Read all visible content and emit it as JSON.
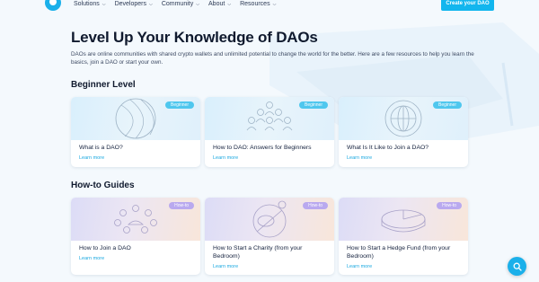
{
  "nav": {
    "items": [
      {
        "label": "Solutions"
      },
      {
        "label": "Developers"
      },
      {
        "label": "Community"
      },
      {
        "label": "About"
      },
      {
        "label": "Resources"
      }
    ],
    "cta_label": "Create your DAO"
  },
  "hero": {
    "title": "Level Up Your Knowledge of DAOs",
    "intro": "DAOs are online communities with shared crypto wallets and unlimited potential to change the world for the better. Here are a few resources to help you learn the basics, join a DAO or start your own."
  },
  "sections": {
    "beginner": {
      "title": "Beginner Level",
      "badge": "Beginner",
      "cards": [
        {
          "title": "What is a DAO?",
          "link": "Learn more",
          "icon": "sphere-illustration"
        },
        {
          "title": "How to DAO: Answers for Beginners",
          "link": "Learn more",
          "icon": "people-group-illustration"
        },
        {
          "title": "What Is It Like to Join a DAO?",
          "link": "Learn more",
          "icon": "globe-illustration"
        }
      ]
    },
    "howto": {
      "title": "How-to Guides",
      "badge": "How-to",
      "cards": [
        {
          "title": "How to Join a DAO",
          "link": "Learn more",
          "icon": "community-circle-illustration"
        },
        {
          "title": "How to Start a Charity (from your Bedroom)",
          "link": "Learn more",
          "icon": "piggy-bank-illustration"
        },
        {
          "title": "How to Start a Hedge Fund (from your Bedroom)",
          "link": "Learn more",
          "icon": "pie-chart-illustration"
        }
      ]
    }
  },
  "colors": {
    "accent": "#12b6ee",
    "beginner_badge": "#4fc7ee",
    "howto_badge": "#b9a9ef",
    "link": "#1aa8e0"
  },
  "fab": {
    "icon": "search-icon"
  }
}
